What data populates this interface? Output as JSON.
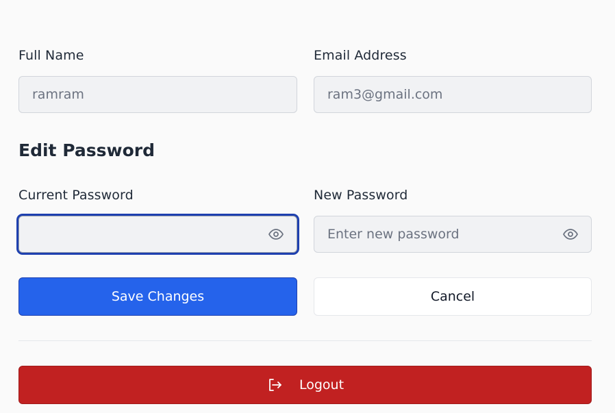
{
  "profile": {
    "full_name_label": "Full Name",
    "full_name_value": "ramram",
    "email_label": "Email Address",
    "email_value": "ram3@gmail.com"
  },
  "password": {
    "section_title": "Edit Password",
    "current_label": "Current Password",
    "current_value": "",
    "new_label": "New Password",
    "new_placeholder": "Enter new password"
  },
  "actions": {
    "save_label": "Save Changes",
    "cancel_label": "Cancel",
    "logout_label": "Logout"
  },
  "colors": {
    "primary": "#2563eb",
    "danger": "#c12121",
    "focus_ring": "#1e40af"
  },
  "icons": {
    "current_toggle": "eye-icon",
    "new_toggle": "eye-icon",
    "logout": "logout-icon"
  }
}
